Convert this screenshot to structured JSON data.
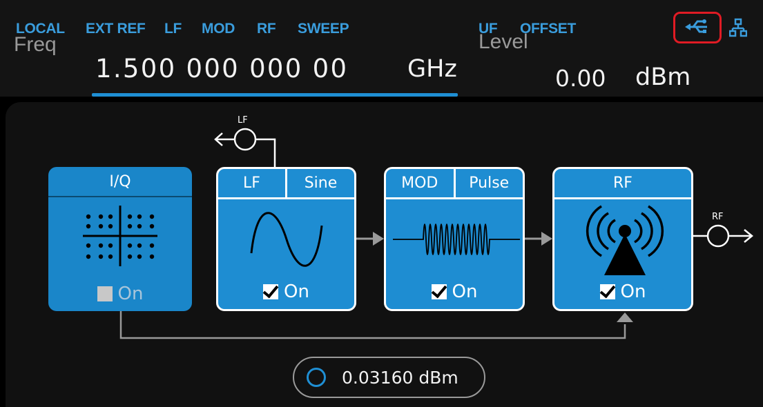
{
  "status_bar": {
    "left_items": [
      "LOCAL",
      "EXT REF",
      "LF",
      "MOD",
      "RF",
      "SWEEP"
    ],
    "right_items": [
      "UF",
      "OFFSET"
    ],
    "icons": [
      "usb-icon",
      "network-icon"
    ],
    "highlight_color": "#e01b24",
    "accent_color": "#3a9ddd"
  },
  "frequency": {
    "label": "Freq",
    "value": "1.500 000 000 00",
    "unit": "GHz"
  },
  "level": {
    "label": "Level",
    "value": "0.00",
    "unit": "dBm"
  },
  "diagram": {
    "lf_output_label": "LF",
    "rf_output_label": "RF",
    "blocks": [
      {
        "id": "iq",
        "title": "I/Q",
        "checkbox_label": "On",
        "checked": false,
        "icon": "constellation-icon"
      },
      {
        "id": "lf",
        "title": "LF",
        "mode": "Sine",
        "checkbox_label": "On",
        "checked": true,
        "icon": "sine-wave-icon"
      },
      {
        "id": "mod",
        "title": "MOD",
        "mode": "Pulse",
        "checkbox_label": "On",
        "checked": true,
        "icon": "pulse-modulation-icon"
      },
      {
        "id": "rf",
        "title": "RF",
        "checkbox_label": "On",
        "checked": true,
        "icon": "antenna-icon"
      }
    ]
  },
  "power_meter": {
    "value": "0.03160 dBm"
  }
}
